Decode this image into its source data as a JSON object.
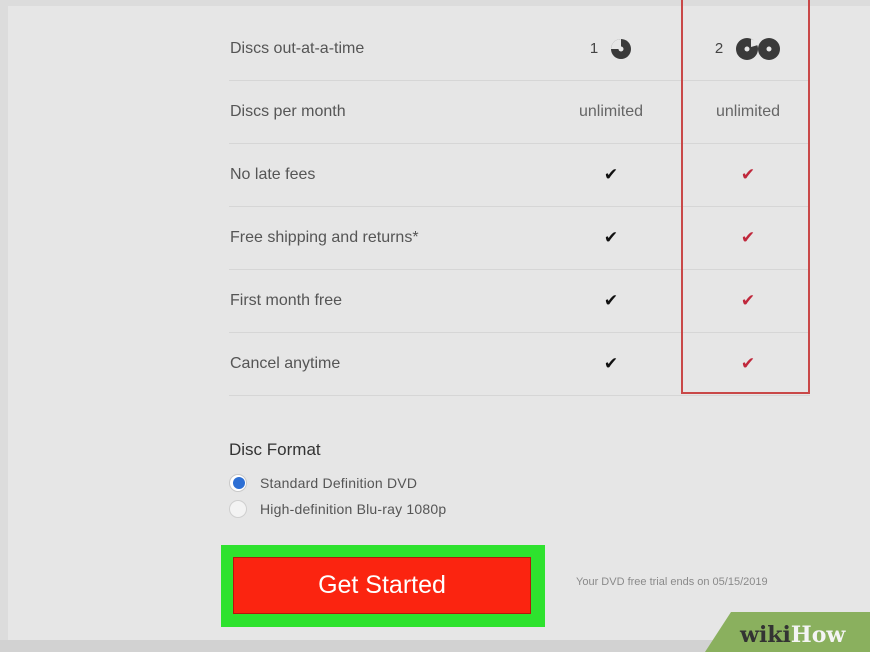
{
  "plans": {
    "rows": [
      {
        "label": "Discs out-at-a-time",
        "plan1": "1",
        "plan2": "2"
      },
      {
        "label": "Discs per month",
        "plan1": "unlimited",
        "plan2": "unlimited"
      },
      {
        "label": "No late fees",
        "plan1_icon": "check-icon",
        "plan2_icon": "check-icon"
      },
      {
        "label": "Free shipping and returns*",
        "plan1_icon": "check-icon",
        "plan2_icon": "check-icon"
      },
      {
        "label": "First month free",
        "plan1_icon": "check-icon",
        "plan2_icon": "check-icon"
      },
      {
        "label": "Cancel anytime",
        "plan1_icon": "check-icon",
        "plan2_icon": "check-icon"
      }
    ],
    "check_glyph": "✔",
    "colors": {
      "plan1_check": "#111111",
      "plan2_check": "#c0283c",
      "highlight_border": "#c94848"
    }
  },
  "disc_format": {
    "title": "Disc Format",
    "options": [
      {
        "label": "Standard Definition DVD",
        "selected": true
      },
      {
        "label": "High-definition Blu-ray 1080p",
        "selected": false
      }
    ]
  },
  "cta": {
    "label": "Get Started",
    "trial_note": "Your DVD free trial ends on 05/15/2019",
    "colors": {
      "button": "#fb2410",
      "outline": "#2ee22e"
    }
  },
  "watermark": {
    "wiki": "wiki",
    "how": "How",
    "color": "#8ab05e"
  }
}
